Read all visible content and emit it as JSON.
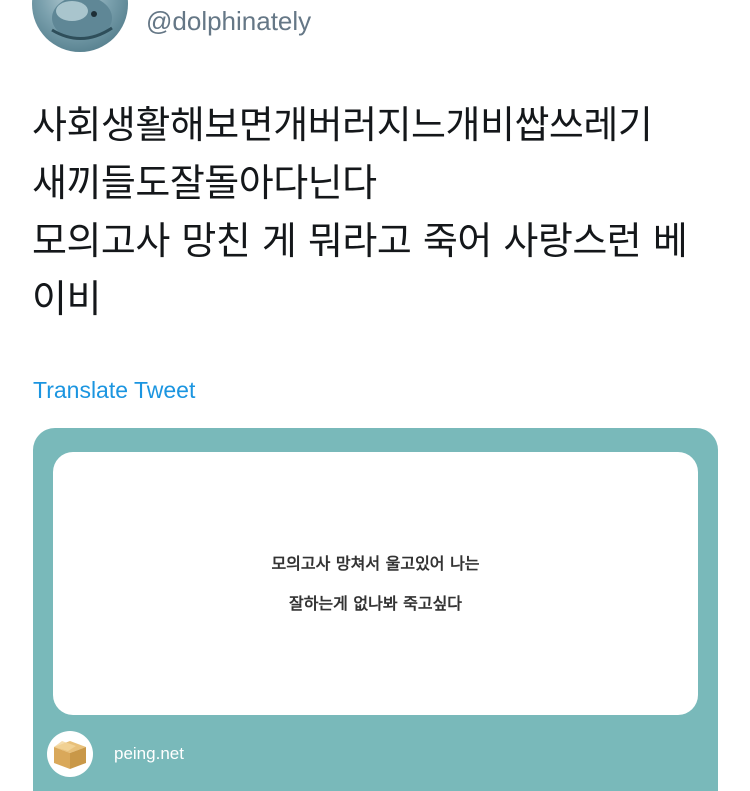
{
  "header": {
    "handle": "@dolphinately",
    "avatar_icon": "dolphin-avatar"
  },
  "tweet": {
    "lines": [
      "사회생활해보면개버러지느개비쌉쓰레기",
      "새끼들도잘돌아다닌다",
      "모의고사 망친 게 뭐라고 죽어 사랑스런 베",
      "이비"
    ],
    "translate_label": "Translate Tweet"
  },
  "card": {
    "question_lines": [
      "모의고사 망쳐서 울고있어 나는",
      "잘하는게 없나봐 죽고싶다"
    ],
    "source": "peing.net",
    "source_icon": "box-icon",
    "background_color": "#79b9ba"
  },
  "colors": {
    "link": "#1b95e0",
    "handle": "#657786",
    "text": "#14171a"
  }
}
